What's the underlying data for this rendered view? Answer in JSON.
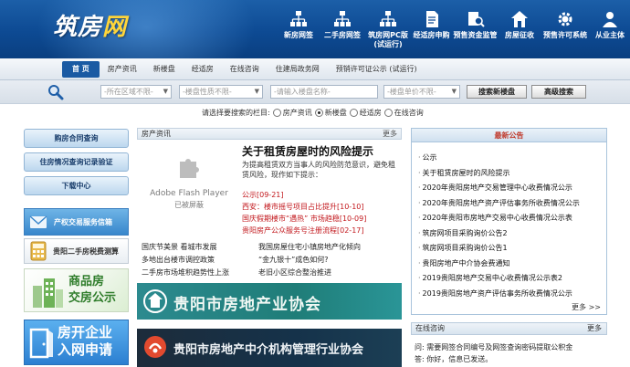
{
  "site": {
    "logo_main": "筑房",
    "logo_accent": "网"
  },
  "topnav": [
    {
      "icon": "network-icon",
      "label": "新房网签",
      "sub": ""
    },
    {
      "icon": "network-icon",
      "label": "二手房网签",
      "sub": ""
    },
    {
      "icon": "network-icon",
      "label": "筑房网PC版",
      "sub": "(试运行)"
    },
    {
      "icon": "document-icon",
      "label": "经适房申购",
      "sub": ""
    },
    {
      "icon": "search-doc-icon",
      "label": "预售资金监管",
      "sub": ""
    },
    {
      "icon": "house-icon",
      "label": "房屋征收",
      "sub": ""
    },
    {
      "icon": "gear-icon",
      "label": "预售许可系统",
      "sub": ""
    },
    {
      "icon": "person-icon",
      "label": "从业主体",
      "sub": ""
    }
  ],
  "menu": [
    "首 页",
    "房产资讯",
    "新楼盘",
    "经适房",
    "在线咨询",
    "住建局政务网",
    "预销许可证公示 (试运行)"
  ],
  "search": {
    "area_placeholder": "-所在区域不限-",
    "type_placeholder": "-楼盘性质不限-",
    "name_placeholder": "-请输入楼盘名称-",
    "price_placeholder": "-楼盘单价不限-",
    "search_button": "搜索新楼盘",
    "advanced_button": "高级搜索",
    "radio_prompt": "请选择要搜索的栏目:",
    "radios": [
      "房产资讯",
      "新楼盘",
      "经适房",
      "在线咨询"
    ],
    "radio_selected": 1
  },
  "left": {
    "btn1": "购房合同查询",
    "btn2": "住房情况查询记录验证",
    "btn3": "下载中心",
    "banner1": "产权交易服务信箱",
    "banner2": "贵阳二手房税费测算",
    "banner3_line1": "商品房",
    "banner3_line2": "交房公示",
    "banner4_line1": "房开企业",
    "banner4_line2": "入网申请"
  },
  "news": {
    "header": "房产资讯",
    "more": "更多",
    "flash_line1": "Adobe Flash Player",
    "flash_line2": "已被屏蔽",
    "headline": "关于租赁房屋时的风险提示",
    "summary": "为提高租赁双方当事人的风险防范意识，避免租赁风险，现作如下提示：",
    "red_links": [
      {
        "text": "公示",
        "date": "[09-21]"
      },
      {
        "text": "西安：楼市摇号项目占比提升",
        "date": "[10-10]"
      },
      {
        "text": "国庆假期楼市“遇热” 市场趋稳",
        "date": "[10-09]"
      },
      {
        "text": "贵阳房产公众服务号注册流程",
        "date": "[02-17]"
      }
    ],
    "list_left": [
      "国庆节美景 看城市发展",
      "多地出台楼市调控政策",
      "二手房市场堆积趋势性上涨"
    ],
    "list_right": [
      "我国房屋住宅小镇房地产化倾向",
      "“金九银十”成色如何?",
      "老旧小区综合整治推进"
    ],
    "banner_assoc": "贵阳市房地产业协会",
    "banner_agency": "贵阳市房地产中介机构管理行业协会"
  },
  "announcements": {
    "header": "最新公告",
    "items": [
      "公示",
      "关于租赁房屋时的风险提示",
      "2020年贵阳房地产交易管理中心收费情况公示",
      "2020年贵阳房地产资产评估事务所收费情况公示",
      "2020年贵阳市房地产交易中心收费情况公示表",
      "筑房网项目采购询价公告2",
      "筑房网项目采购询价公告1",
      "贵阳房地产中介协会费通知",
      "2019贵阳房地产交易中心收费情况公示表2",
      "2019贵阳房地产资产评估事务所收费情况公示"
    ],
    "more": "更多 >>"
  },
  "qa": {
    "header": "在线咨询",
    "more": "更多",
    "question": "问: 需要网签合同编号及网签查询密码提取公积金",
    "answer": "答: 你好，信息已发送。"
  },
  "colors": {
    "brand_blue": "#0d4a93",
    "accent_red": "#c2171c",
    "assoc_green": "#1f7d78"
  }
}
